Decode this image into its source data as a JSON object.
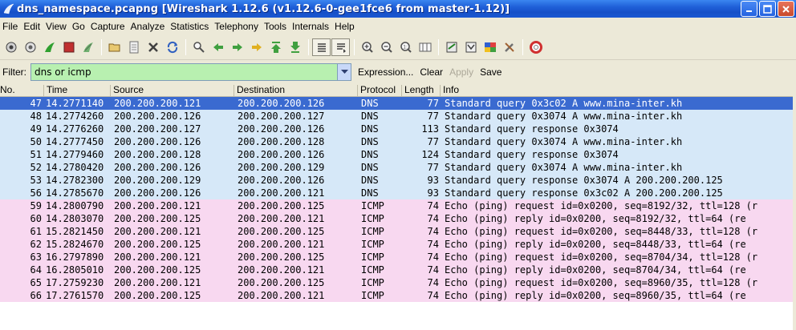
{
  "window": {
    "title": "dns_namespace.pcapng   [Wireshark 1.12.6  (v1.12.6-0-gee1fce6 from master-1.12)]",
    "buttons": [
      "minimize-icon",
      "maximize-icon",
      "close-icon"
    ]
  },
  "menu": [
    "File",
    "Edit",
    "View",
    "Go",
    "Capture",
    "Analyze",
    "Statistics",
    "Telephony",
    "Tools",
    "Internals",
    "Help"
  ],
  "toolbar": {
    "icons": [
      "interfaces-icon",
      "options-icon",
      "start-capture-icon",
      "stop-capture-icon",
      "restart-capture-icon",
      "sep",
      "open-icon",
      "save-icon",
      "close-file-icon",
      "reload-icon",
      "sep",
      "find-icon",
      "go-back-icon",
      "go-forward-icon",
      "go-to-packet-icon",
      "go-first-icon",
      "go-last-icon",
      "sep",
      "colorize-icon",
      "autoscroll-icon",
      "sep",
      "zoom-in-icon",
      "zoom-out-icon",
      "zoom-normal-icon",
      "resize-columns-icon",
      "sep",
      "capture-filters-icon",
      "display-filters-icon",
      "coloring-rules-icon",
      "preferences-icon",
      "sep",
      "help-icon"
    ]
  },
  "filter": {
    "label": "Filter:",
    "value": "dns or icmp",
    "expression": "Expression...",
    "clear": "Clear",
    "apply": "Apply",
    "save": "Save"
  },
  "columns": {
    "no": "No.",
    "time": "Time",
    "source": "Source",
    "destination": "Destination",
    "protocol": "Protocol",
    "length": "Length",
    "info": "Info"
  },
  "packets": [
    {
      "no": "47",
      "time": "14.2771140",
      "src": "200.200.200.121",
      "dst": "200.200.200.126",
      "proto": "DNS",
      "len": "77",
      "info": "Standard query 0x3c02  A www.mina-inter.kh",
      "selected": true
    },
    {
      "no": "48",
      "time": "14.2774260",
      "src": "200.200.200.126",
      "dst": "200.200.200.127",
      "proto": "DNS",
      "len": "77",
      "info": "Standard query 0x3074  A www.mina-inter.kh"
    },
    {
      "no": "49",
      "time": "14.2776260",
      "src": "200.200.200.127",
      "dst": "200.200.200.126",
      "proto": "DNS",
      "len": "113",
      "info": "Standard query response 0x3074"
    },
    {
      "no": "50",
      "time": "14.2777450",
      "src": "200.200.200.126",
      "dst": "200.200.200.128",
      "proto": "DNS",
      "len": "77",
      "info": "Standard query 0x3074  A www.mina-inter.kh"
    },
    {
      "no": "51",
      "time": "14.2779460",
      "src": "200.200.200.128",
      "dst": "200.200.200.126",
      "proto": "DNS",
      "len": "124",
      "info": "Standard query response 0x3074"
    },
    {
      "no": "52",
      "time": "14.2780420",
      "src": "200.200.200.126",
      "dst": "200.200.200.129",
      "proto": "DNS",
      "len": "77",
      "info": "Standard query 0x3074  A www.mina-inter.kh"
    },
    {
      "no": "53",
      "time": "14.2782300",
      "src": "200.200.200.129",
      "dst": "200.200.200.126",
      "proto": "DNS",
      "len": "93",
      "info": "Standard query response 0x3074  A 200.200.200.125"
    },
    {
      "no": "56",
      "time": "14.2785670",
      "src": "200.200.200.126",
      "dst": "200.200.200.121",
      "proto": "DNS",
      "len": "93",
      "info": "Standard query response 0x3c02  A 200.200.200.125"
    },
    {
      "no": "59",
      "time": "14.2800790",
      "src": "200.200.200.121",
      "dst": "200.200.200.125",
      "proto": "ICMP",
      "len": "74",
      "info": "Echo (ping) request  id=0x0200, seq=8192/32, ttl=128 (r"
    },
    {
      "no": "60",
      "time": "14.2803070",
      "src": "200.200.200.125",
      "dst": "200.200.200.121",
      "proto": "ICMP",
      "len": "74",
      "info": "Echo (ping) reply    id=0x0200, seq=8192/32, ttl=64 (re"
    },
    {
      "no": "61",
      "time": "15.2821450",
      "src": "200.200.200.121",
      "dst": "200.200.200.125",
      "proto": "ICMP",
      "len": "74",
      "info": "Echo (ping) request  id=0x0200, seq=8448/33, ttl=128 (r"
    },
    {
      "no": "62",
      "time": "15.2824670",
      "src": "200.200.200.125",
      "dst": "200.200.200.121",
      "proto": "ICMP",
      "len": "74",
      "info": "Echo (ping) reply    id=0x0200, seq=8448/33, ttl=64 (re"
    },
    {
      "no": "63",
      "time": "16.2797890",
      "src": "200.200.200.121",
      "dst": "200.200.200.125",
      "proto": "ICMP",
      "len": "74",
      "info": "Echo (ping) request  id=0x0200, seq=8704/34, ttl=128 (r"
    },
    {
      "no": "64",
      "time": "16.2805010",
      "src": "200.200.200.125",
      "dst": "200.200.200.121",
      "proto": "ICMP",
      "len": "74",
      "info": "Echo (ping) reply    id=0x0200, seq=8704/34, ttl=64 (re"
    },
    {
      "no": "65",
      "time": "17.2759230",
      "src": "200.200.200.121",
      "dst": "200.200.200.125",
      "proto": "ICMP",
      "len": "74",
      "info": "Echo (ping) request  id=0x0200, seq=8960/35, ttl=128 (r"
    },
    {
      "no": "66",
      "time": "17.2761570",
      "src": "200.200.200.125",
      "dst": "200.200.200.121",
      "proto": "ICMP",
      "len": "74",
      "info": "Echo (ping) reply    id=0x0200, seq=8960/35, ttl=64 (re"
    }
  ],
  "colors": {
    "dns_row": "#d6e8f8",
    "icmp_row": "#f8d8f0",
    "selected_row": "#3a6ad0",
    "filter_valid": "#b8f0b0"
  }
}
